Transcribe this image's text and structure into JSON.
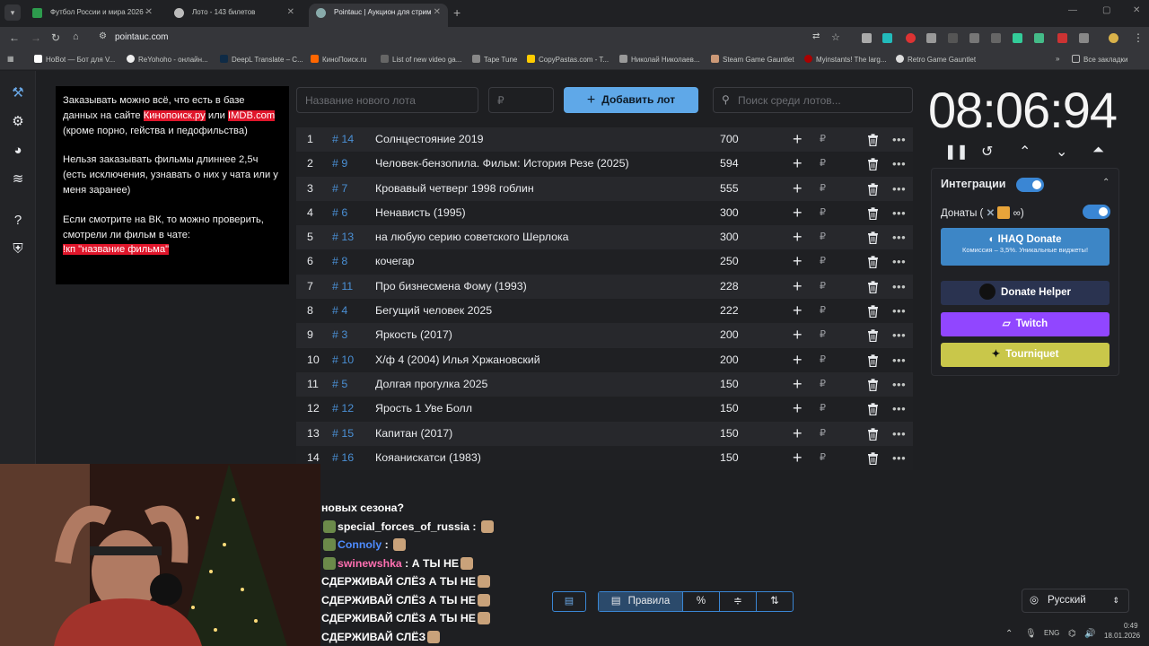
{
  "browser": {
    "tabs": [
      {
        "title": "Футбол России и мира 2026 -",
        "active": false
      },
      {
        "title": "Лото - 143 билетов",
        "active": false
      },
      {
        "title": "Pointauc | Аукцион для стрим",
        "active": true
      }
    ],
    "url": "pointauc.com",
    "bookmarks": [
      "HoBot — Бот для V...",
      "ReYohoho - онлайн...",
      "DeepL Translate – C...",
      "КиноПоиск.ru",
      "List of new video ga...",
      "Tape Tune",
      "CopyPastas.com - T...",
      "Николай Николаев...",
      "Steam Game Gauntlet",
      "Myinstants! The larg...",
      "Retro Game Gauntlet"
    ],
    "all_bookmarks": "Все закладки"
  },
  "rules": {
    "p1_a": "Заказывать можно всё, что есть в базе данных на сайте ",
    "p1_link1": "Кинопоиск.ру",
    "p1_b": " или ",
    "p1_link2": "IMDB.com",
    "p1_c": " (кроме порно, гейства и педофильства)",
    "p2": "Нельзя заказывать фильмы длиннее 2,5ч (есть исключения, узнавать о них у чата или у меня заранее)",
    "p3": "Если смотрите на ВК, то можно проверить, смотрели ли фильм в чате:",
    "p3_cmd": "!кп \"название фильма\""
  },
  "inputs": {
    "new_lot_placeholder": "Название нового лота",
    "amount_placeholder": "₽",
    "add_button": "Добавить лот",
    "search_placeholder": "Поиск среди лотов..."
  },
  "lots": [
    {
      "n": "1",
      "id": "# 14",
      "name": "Солнцестояние 2019",
      "amount": "700"
    },
    {
      "n": "2",
      "id": "# 9",
      "name": "Человек-бензопила. Фильм: История Резе (2025)",
      "amount": "594"
    },
    {
      "n": "3",
      "id": "# 7",
      "name": "Кровавый четверг 1998 гоблин",
      "amount": "555"
    },
    {
      "n": "4",
      "id": "# 6",
      "name": "Ненависть (1995)",
      "amount": "300"
    },
    {
      "n": "5",
      "id": "# 13",
      "name": "на любую серию советского Шерлока",
      "amount": "300"
    },
    {
      "n": "6",
      "id": "# 8",
      "name": "кочегар",
      "amount": "250"
    },
    {
      "n": "7",
      "id": "# 11",
      "name": "Про бизнесмена Фому (1993)",
      "amount": "228"
    },
    {
      "n": "8",
      "id": "# 4",
      "name": "Бегущий человек 2025",
      "amount": "222"
    },
    {
      "n": "9",
      "id": "# 3",
      "name": "Яркость (2017)",
      "amount": "200"
    },
    {
      "n": "10",
      "id": "# 10",
      "name": "Х/ф 4 (2004) Илья Хржановский",
      "amount": "200"
    },
    {
      "n": "11",
      "id": "# 5",
      "name": "Долгая прогулка 2025",
      "amount": "150"
    },
    {
      "n": "12",
      "id": "# 12",
      "name": "Ярость 1 Уве Болл",
      "amount": "150"
    },
    {
      "n": "13",
      "id": "# 15",
      "name": "Капитан (2017)",
      "amount": "150"
    },
    {
      "n": "14",
      "id": "# 16",
      "name": "Кояанискатси (1983)",
      "amount": "150"
    }
  ],
  "row_plus": "+",
  "row_rub": "₽",
  "row_more": "•••",
  "timer": "08:06:94",
  "integrations": {
    "title": "Интеграции",
    "donations_label": "Донаты (",
    "donations_close": ")",
    "ihaq_title": "IHAQ Donate",
    "ihaq_sub": "Комиссия – 3,5%. Уникальные виджеты!",
    "donate_helper": "Donate Helper",
    "twitch": "Twitch",
    "tourniquet": "Tourniquet"
  },
  "chat": [
    {
      "user": "",
      "text": "новых сезона?"
    },
    {
      "user": "special_forces_of_russia",
      "text": ""
    },
    {
      "user": "Connoly",
      "text": ""
    },
    {
      "user": "swinewshka",
      "text": "А ТЫ НЕ"
    },
    {
      "user": "",
      "text": "СДЕРЖИВАЙ  СЛЁЗ  А ТЫ НЕ"
    },
    {
      "user": "",
      "text": "СДЕРЖИВАЙ  СЛЁЗ  А ТЫ НЕ"
    },
    {
      "user": "",
      "text": "СДЕРЖИВАЙ  СЛЁЗ  А ТЫ НЕ"
    },
    {
      "user": "",
      "text": "СДЕРЖИВАЙ  СЛЁЗ"
    }
  ],
  "chat_sep": " :",
  "bottom": {
    "rules_button": "Правила",
    "percent_button": "%",
    "language": "Русский"
  },
  "tray": {
    "lang": "ENG",
    "time": "0:49",
    "date": "18.01.2026"
  },
  "colors": {
    "accent": "#5fa8e8",
    "id_link": "#4a8fd4",
    "highlight": "#e0162b",
    "twitch": "#9146ff",
    "tourniquet": "#c9c74a",
    "ihaq": "#3d86c6",
    "donate_helper": "#2a3350"
  }
}
